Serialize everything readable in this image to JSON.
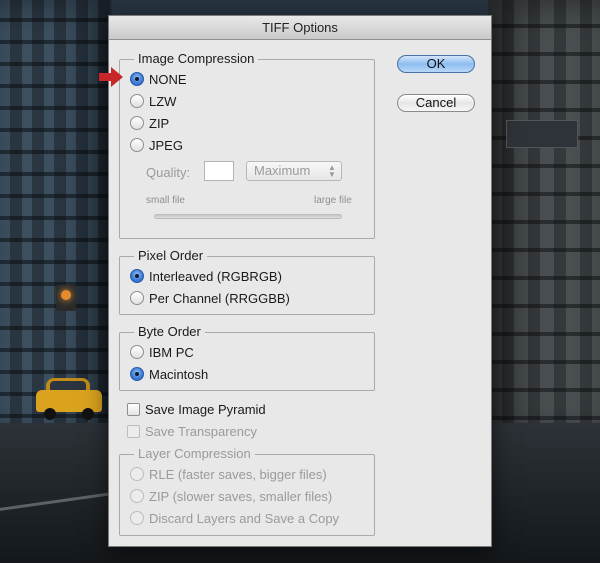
{
  "dialog": {
    "title": "TIFF Options"
  },
  "buttons": {
    "ok": "OK",
    "cancel": "Cancel"
  },
  "image_compression": {
    "legend": "Image Compression",
    "options": [
      "NONE",
      "LZW",
      "ZIP",
      "JPEG"
    ],
    "selected": "NONE",
    "quality_label": "Quality:",
    "quality_value": "",
    "quality_preset": "Maximum",
    "small_file": "small file",
    "large_file": "large file"
  },
  "pixel_order": {
    "legend": "Pixel Order",
    "options": [
      "Interleaved (RGBRGB)",
      "Per Channel (RRGGBB)"
    ],
    "selected": "Interleaved (RGBRGB)"
  },
  "byte_order": {
    "legend": "Byte Order",
    "options": [
      "IBM PC",
      "Macintosh"
    ],
    "selected": "Macintosh"
  },
  "checkboxes": {
    "save_image_pyramid": "Save Image Pyramid",
    "save_transparency": "Save Transparency"
  },
  "layer_compression": {
    "legend": "Layer Compression",
    "options": [
      "RLE (faster saves, bigger files)",
      "ZIP (slower saves, smaller files)",
      "Discard Layers and Save a Copy"
    ]
  },
  "colors": {
    "accent": "#3b7fd8",
    "arrow": "#c8272a",
    "taxi": "#d9a21f"
  }
}
